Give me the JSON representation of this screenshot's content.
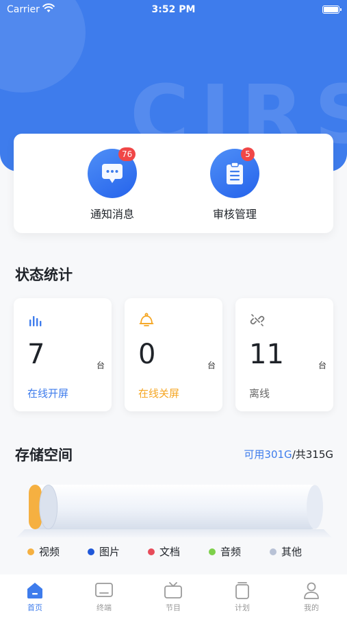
{
  "status_bar": {
    "carrier": "Carrier",
    "time": "3:52 PM"
  },
  "header": {
    "watermark": "CIRS"
  },
  "quick_actions": [
    {
      "label": "通知消息",
      "badge": "76",
      "icon": "chat-bubble-icon"
    },
    {
      "label": "审核管理",
      "badge": "5",
      "icon": "clipboard-icon"
    }
  ],
  "status_stats": {
    "title": "状态统计",
    "cards": [
      {
        "value": "7",
        "unit": "台",
        "label": "在线开屏",
        "icon": "bar-signal-icon",
        "color": "#3e7cec"
      },
      {
        "value": "0",
        "unit": "台",
        "label": "在线关屏",
        "icon": "bell-icon",
        "color": "#f5a623"
      },
      {
        "value": "11",
        "unit": "台",
        "label": "离线",
        "icon": "broken-link-icon",
        "color": "#888888"
      }
    ]
  },
  "storage": {
    "title": "存储空间",
    "available": "可用301G",
    "total": "/共315G",
    "used_fraction": 0.044,
    "legend": [
      {
        "label": "视频",
        "color": "#f5b041"
      },
      {
        "label": "图片",
        "color": "#2058d9"
      },
      {
        "label": "文档",
        "color": "#e74c5a"
      },
      {
        "label": "音频",
        "color": "#7ed04b"
      },
      {
        "label": "其他",
        "color": "#b8c2d6"
      }
    ]
  },
  "tabbar": {
    "active": "首页",
    "items": [
      {
        "label": "首页",
        "icon": "home-icon"
      },
      {
        "label": "终端",
        "icon": "terminal-screen-icon"
      },
      {
        "label": "节目",
        "icon": "tv-icon"
      },
      {
        "label": "计划",
        "icon": "plan-icon"
      },
      {
        "label": "我的",
        "icon": "user-icon"
      }
    ]
  },
  "colors": {
    "primary": "#3e7cec",
    "badge": "#f04747",
    "warning": "#f5a623",
    "muted": "#888888"
  }
}
